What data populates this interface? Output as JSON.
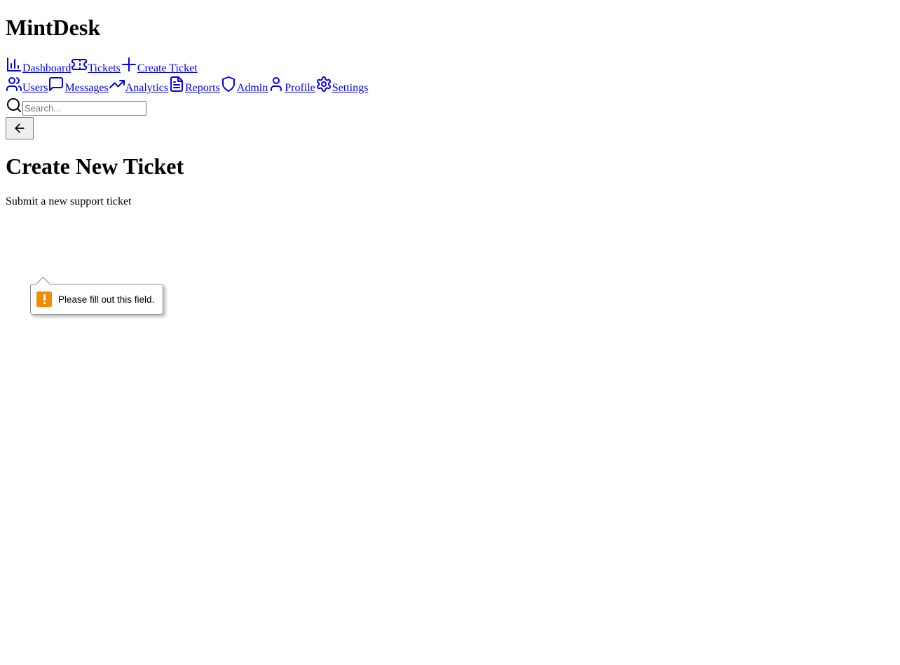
{
  "app": {
    "title": "MintDesk"
  },
  "nav": {
    "primary": [
      {
        "label": "Dashboard",
        "icon": "bar-chart-icon"
      },
      {
        "label": "Tickets",
        "icon": "ticket-icon"
      },
      {
        "label": "Create Ticket",
        "icon": "plus-icon"
      }
    ],
    "secondary": [
      {
        "label": "Users",
        "icon": "users-icon"
      },
      {
        "label": "Messages",
        "icon": "message-icon"
      },
      {
        "label": "Analytics",
        "icon": "trending-up-icon"
      },
      {
        "label": "Reports",
        "icon": "file-text-icon"
      },
      {
        "label": "Admin",
        "icon": "shield-icon"
      },
      {
        "label": "Profile",
        "icon": "user-icon"
      },
      {
        "label": "Settings",
        "icon": "gear-icon"
      }
    ]
  },
  "search": {
    "placeholder": "Search...",
    "value": ""
  },
  "page": {
    "title": "Create New Ticket",
    "subtitle": "Submit a new support ticket"
  },
  "validation": {
    "message": "Please fill out this field."
  },
  "colors": {
    "link": "#0000ee",
    "warning": "#f28c00"
  }
}
